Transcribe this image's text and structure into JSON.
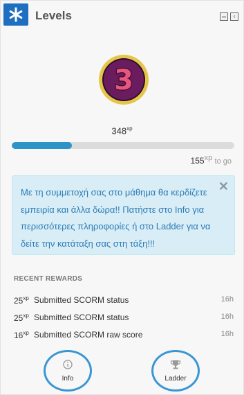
{
  "block": {
    "title": "Levels",
    "icon": "asterisk-icon",
    "accent_color": "#1f6fc0"
  },
  "level": {
    "number": "3",
    "badge_colors": {
      "ring": "#e6c64a",
      "fill": "#6b1c5e",
      "digit": "#e8557f"
    }
  },
  "xp": {
    "total": "348",
    "total_unit": "xp",
    "to_go": "155",
    "to_go_unit": "xp",
    "to_go_suffix": "to go",
    "progress_fraction": 0.27
  },
  "alert": {
    "text": "Με τη συμμετοχή σας στο μάθημα θα κερδίζετε εμπειρία και άλλα δώρα!! Πατήστε στο Info για περισσότερες πληροφορίες ή στο Ladder για να δείτε την κατάταξη σας στη τάξη!!!",
    "close_symbol": "✕"
  },
  "recent_rewards": {
    "heading": "RECENT REWARDS",
    "items": [
      {
        "points": "25",
        "unit": "xp",
        "description": "Submitted SCORM status",
        "time": "16h"
      },
      {
        "points": "25",
        "unit": "xp",
        "description": "Submitted SCORM status",
        "time": "16h"
      },
      {
        "points": "16",
        "unit": "xp",
        "description": "Submitted SCORM raw score",
        "time": "16h"
      }
    ]
  },
  "nav": {
    "info_label": "Info",
    "ladder_label": "Ladder"
  }
}
